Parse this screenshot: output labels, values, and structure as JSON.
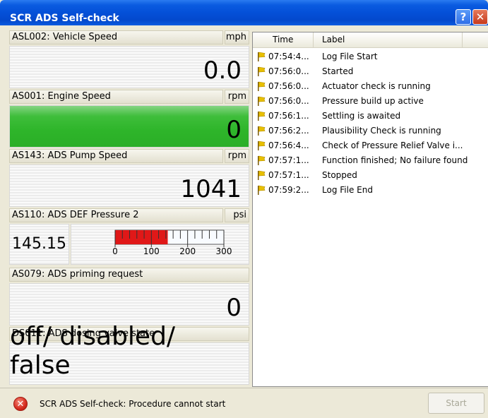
{
  "window": {
    "title": "SCR ADS Self-check",
    "help_label": "?",
    "close_label": "✕"
  },
  "gauges": [
    {
      "label": "ASL002: Vehicle Speed",
      "unit": "mph",
      "value": "0.0"
    },
    {
      "label": "AS001: Engine Speed",
      "unit": "rpm",
      "value": "0"
    },
    {
      "label": "AS143: ADS Pump Speed",
      "unit": "rpm",
      "value": "1041"
    },
    {
      "label": "AS110: ADS DEF Pressure 2",
      "unit": "psi",
      "value": "145.15"
    },
    {
      "label": "AS079: ADS priming request",
      "unit": "",
      "value": "0"
    },
    {
      "label": "DS011: ADS dosing valve state",
      "unit": "",
      "value": "off/ disabled/ false"
    }
  ],
  "pressure_bar": {
    "min": 0,
    "max": 300,
    "value": 145.15,
    "ticks": [
      "0",
      "100",
      "200",
      "300"
    ],
    "fill_color": "#E01818"
  },
  "log": {
    "col_time": "Time",
    "col_label": "Label",
    "rows": [
      {
        "time": "07:54:4...",
        "label": "Log File Start"
      },
      {
        "time": "07:56:0...",
        "label": "Started"
      },
      {
        "time": "07:56:0...",
        "label": "Actuator check is running"
      },
      {
        "time": "07:56:0...",
        "label": "Pressure build up active"
      },
      {
        "time": "07:56:1...",
        "label": "Settling is awaited"
      },
      {
        "time": "07:56:2...",
        "label": "Plausibility Check is running"
      },
      {
        "time": "07:56:4...",
        "label": "Check of Pressure Relief Valve i..."
      },
      {
        "time": "07:57:1...",
        "label": "Function finished; No failure found"
      },
      {
        "time": "07:57:1...",
        "label": "Stopped"
      },
      {
        "time": "07:59:2...",
        "label": "Log File End"
      }
    ]
  },
  "status": {
    "icon": "error-icon",
    "message": "SCR ADS Self-check: Procedure cannot start",
    "start_label": "Start"
  },
  "colors": {
    "title_bar": "#0450D8",
    "engine_speed_bg": "#2EB52A",
    "flag": "#E8C000"
  }
}
